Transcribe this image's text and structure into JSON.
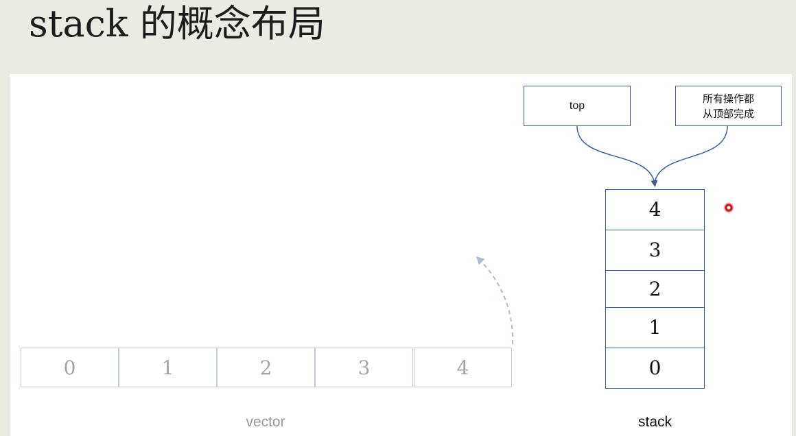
{
  "title": {
    "latin": "stack",
    "cjk": " 的概念布局"
  },
  "diagram": {
    "vector": {
      "cells": [
        "0",
        "1",
        "2",
        "3",
        "4"
      ],
      "caption": "vector"
    },
    "stack": {
      "cells_top_to_bottom": [
        "4",
        "3",
        "2",
        "1",
        "0"
      ],
      "caption": "stack"
    },
    "callouts": {
      "top_label": "top",
      "note_line1": "所有操作都",
      "note_line2": "从顶部完成"
    },
    "colors": {
      "stack_border": "#3a5d9c",
      "vector_border": "#c4cde0",
      "dashed_arrow": "#aebbd8",
      "pointer": "#d0101a"
    }
  }
}
